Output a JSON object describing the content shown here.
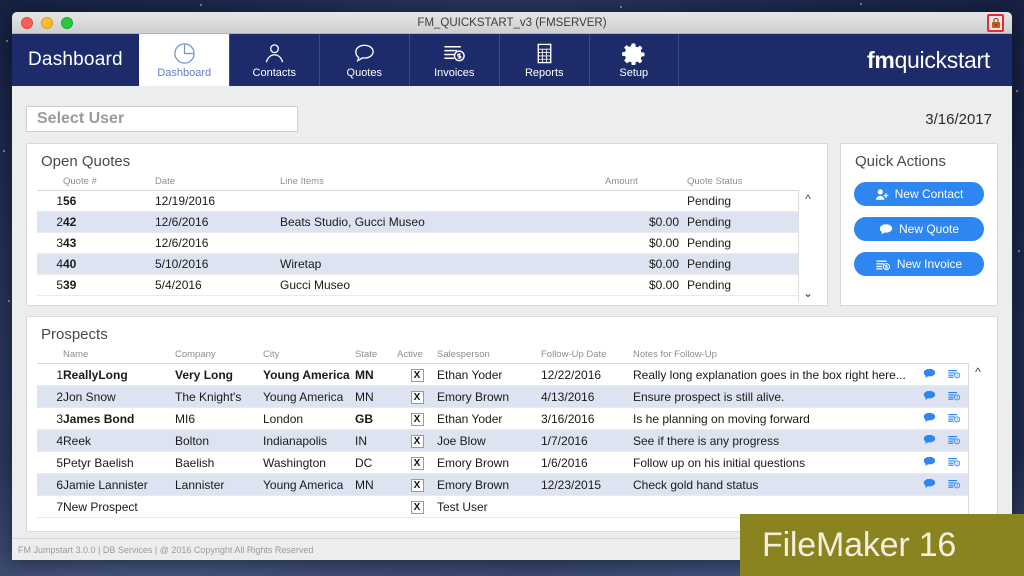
{
  "window": {
    "title": "FM_QUICKSTART_v3 (FMSERVER)",
    "lock_icon": "lock-icon",
    "traffic_lights": [
      "close",
      "minimize",
      "zoom"
    ]
  },
  "nav": {
    "app_label": "Dashboard",
    "brand_bold": "fm",
    "brand_light": "quickstart",
    "tabs": [
      {
        "label": "Dashboard",
        "icon": "pie-chart-icon",
        "active": true
      },
      {
        "label": "Contacts",
        "icon": "person-icon",
        "active": false
      },
      {
        "label": "Quotes",
        "icon": "speech-bubble-icon",
        "active": false
      },
      {
        "label": "Invoices",
        "icon": "invoice-dollar-icon",
        "active": false
      },
      {
        "label": "Reports",
        "icon": "report-grid-icon",
        "active": false
      },
      {
        "label": "Setup",
        "icon": "gear-icon",
        "active": false
      }
    ]
  },
  "toolbar": {
    "select_user_placeholder": "Select User",
    "select_user_value": "",
    "date": "3/16/2017"
  },
  "open_quotes": {
    "title": "Open Quotes",
    "columns": [
      "",
      "Quote #",
      "Date",
      "Line Items",
      "Amount",
      "Quote Status"
    ],
    "rows": [
      {
        "n": "1",
        "quote": "56",
        "date": "12/19/2016",
        "items": "",
        "amount": "",
        "status": "Pending"
      },
      {
        "n": "2",
        "quote": "42",
        "date": "12/6/2016",
        "items": "Beats Studio, Gucci Museo",
        "amount": "$0.00",
        "status": "Pending"
      },
      {
        "n": "3",
        "quote": "43",
        "date": "12/6/2016",
        "items": "",
        "amount": "$0.00",
        "status": "Pending"
      },
      {
        "n": "4",
        "quote": "40",
        "date": "5/10/2016",
        "items": "Wiretap",
        "amount": "$0.00",
        "status": "Pending"
      },
      {
        "n": "5",
        "quote": "39",
        "date": "5/4/2016",
        "items": "Gucci Museo",
        "amount": "$0.00",
        "status": "Pending"
      }
    ],
    "scroll_up_icon": "chevron-up-icon",
    "scroll_down_icon": "chevron-down-icon"
  },
  "quick_actions": {
    "title": "Quick Actions",
    "buttons": [
      {
        "label": "New Contact",
        "icon": "add-person-icon"
      },
      {
        "label": "New Quote",
        "icon": "speech-bubble-icon"
      },
      {
        "label": "New Invoice",
        "icon": "invoice-dollar-icon"
      }
    ],
    "button_color": "#2e86f0"
  },
  "prospects": {
    "title": "Prospects",
    "columns": [
      "",
      "Name",
      "Company",
      "City",
      "State",
      "Active",
      "Salesperson",
      "Follow-Up Date",
      "Notes for Follow-Up",
      ""
    ],
    "rows": [
      {
        "n": "1",
        "name": "ReallyLong",
        "company": "Very Long",
        "city": "Young America",
        "state": "MN",
        "active": "X",
        "salesperson": "Ethan Yoder",
        "followup": "12/22/2016",
        "notes": "Really long explanation goes in the box right here..."
      },
      {
        "n": "2",
        "name": "Jon Snow",
        "company": "The Knight's",
        "city": "Young America",
        "state": "MN",
        "active": "X",
        "salesperson": "Emory Brown",
        "followup": "4/13/2016",
        "notes": "Ensure prospect is still alive."
      },
      {
        "n": "3",
        "name": "James Bond",
        "company": "MI6",
        "city": "London",
        "state": "GB",
        "active": "X",
        "salesperson": "Ethan Yoder",
        "followup": "3/16/2016",
        "notes": "Is he planning on moving forward"
      },
      {
        "n": "4",
        "name": "Reek",
        "company": "Bolton",
        "city": "Indianapolis",
        "state": "IN",
        "active": "X",
        "salesperson": "Joe Blow",
        "followup": "1/7/2016",
        "notes": "See if there is any progress"
      },
      {
        "n": "5",
        "name": "Petyr Baelish",
        "company": "Baelish",
        "city": "Washington",
        "state": "DC",
        "active": "X",
        "salesperson": "Emory Brown",
        "followup": "1/6/2016",
        "notes": "Follow up on his initial questions"
      },
      {
        "n": "6",
        "name": "Jamie Lannister",
        "company": "Lannister",
        "city": "Young America",
        "state": "MN",
        "active": "X",
        "salesperson": "Emory Brown",
        "followup": "12/23/2015",
        "notes": "Check gold hand status"
      },
      {
        "n": "7",
        "name": "New Prospect",
        "company": "",
        "city": "",
        "state": "",
        "active": "X",
        "salesperson": "Test User",
        "followup": "",
        "notes": ""
      }
    ],
    "row_icons": [
      "speech-bubble-icon",
      "invoice-dollar-icon"
    ],
    "scroll_up_icon": "chevron-up-icon"
  },
  "footer": {
    "text": "FM Jumpstart 3.0.0  | DB Services | @ 2016 Copyright All Rights Reserved"
  },
  "watermark": {
    "label": "FileMaker 16",
    "background": "#8a8420"
  },
  "theme": {
    "nav_blue": "#1d2b6b",
    "accent_blue": "#2e86f0",
    "alt_row": "#dde3f0",
    "window_bg": "#eceded"
  }
}
